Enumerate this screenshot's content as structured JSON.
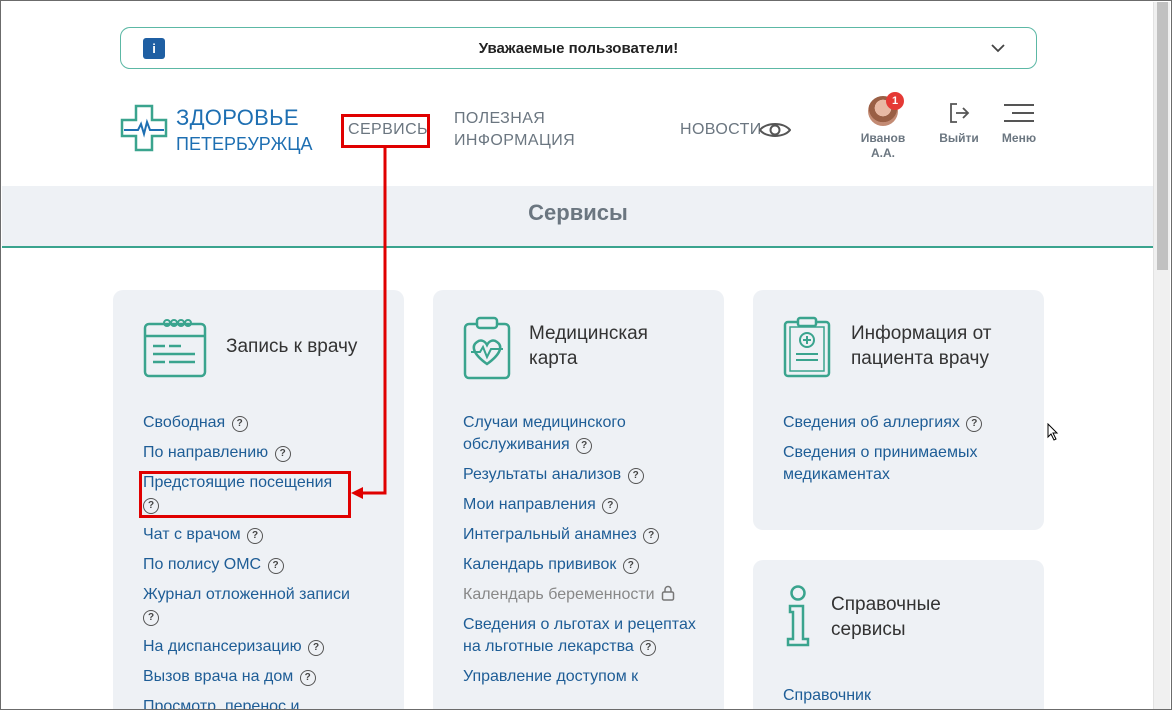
{
  "notice": {
    "icon": "info-icon",
    "icon_glyph": "i",
    "text": "Уважаемые пользователи!"
  },
  "header": {
    "logo": {
      "line1": "ЗДОРОВЬЕ",
      "line2": "ПЕТЕРБУРЖЦА"
    },
    "nav": {
      "services": "СЕРВИСЫ",
      "info_line1": "ПОЛЕЗНАЯ",
      "info_line2": "ИНФОРМАЦИЯ",
      "news": "НОВОСТИ"
    },
    "user": {
      "name_line1": "Иванов",
      "name_line2": "А.А.",
      "badge": "1"
    },
    "logout_label": "Выйти",
    "menu_label": "Меню"
  },
  "page_title": "Сервисы",
  "cards": {
    "appointment": {
      "title": "Запись к врачу",
      "links": [
        "Свободная",
        "По направлению",
        "Предстоящие посещения",
        "Чат с врачом",
        "По полису ОМС",
        "Журнал отложенной записи",
        "На диспансеризацию",
        "Вызов врача на дом",
        "Просмотр, перенос и"
      ]
    },
    "medcard": {
      "title_line1": "Медицинская",
      "title_line2": "карта",
      "links": [
        "Случаи медицинского обслуживания",
        "Результаты анализов",
        "Мои направления",
        "Интегральный анамнез",
        "Календарь прививок",
        "Календарь беременности",
        "Сведения о льготах и рецептах на льготные лекарства",
        "Управление доступом к"
      ]
    },
    "patient_info": {
      "title_line1": "Информация от",
      "title_line2": "пациента врачу",
      "links": [
        "Сведения об аллергиях",
        "Сведения о принимаемых медикаментах"
      ]
    },
    "reference": {
      "title_line1": "Справочные",
      "title_line2": "сервисы",
      "links": [
        "Справочник"
      ]
    }
  },
  "help_glyph": "?",
  "colors": {
    "brand_blue": "#1e6fb2",
    "link_blue": "#1e5d96",
    "accent_green": "#3aa48e",
    "annotation_red": "#e00000",
    "card_bg": "#eef1f5"
  }
}
